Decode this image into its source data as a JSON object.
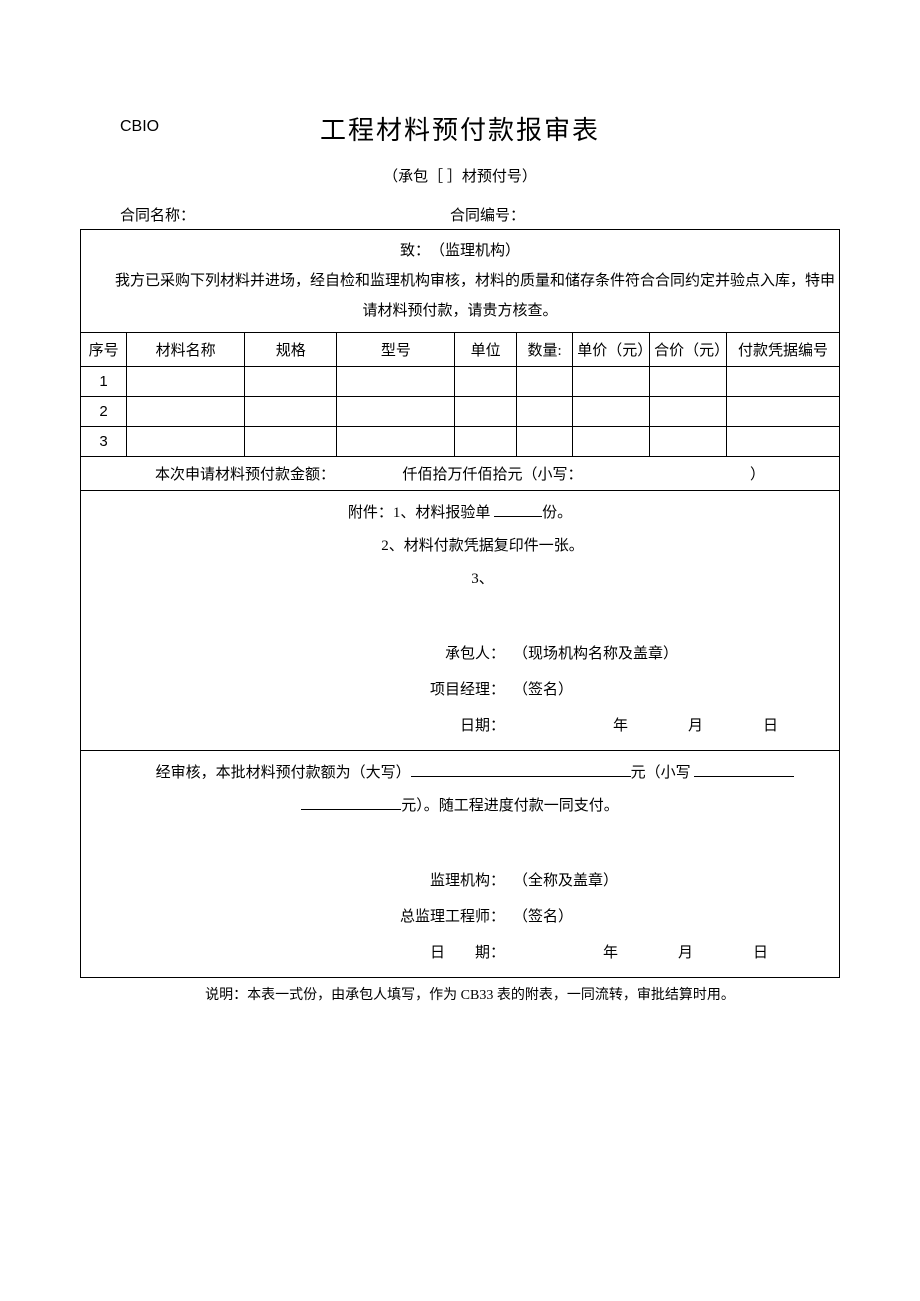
{
  "doc_code": "CBIO",
  "title": "工程材料预付款报审表",
  "subtitle": "（承包［ ］材预付号）",
  "contract": {
    "name_label": "合同名称：",
    "no_label": "合同编号："
  },
  "intro": {
    "to": "致：　（监理机构）",
    "body": "我方已采购下列材料并进场，经自检和监理机构审核，材料的质量和储存条件符合合同约定并验点入库，特申请材料预付款，请贵方核查。"
  },
  "headers": {
    "seq": "序号",
    "name": "材料名称",
    "spec": "规格",
    "model": "型号",
    "unit": "单位",
    "qty": "数量:",
    "unit_price": "单价（元）",
    "total_price": "合价（元）",
    "voucher": "付款凭据编号"
  },
  "rows": [
    {
      "seq": "1",
      "name": "",
      "spec": "",
      "model": "",
      "unit": "",
      "qty": "",
      "unit_price": "",
      "total_price": "",
      "voucher": ""
    },
    {
      "seq": "2",
      "name": "",
      "spec": "",
      "model": "",
      "unit": "",
      "qty": "",
      "unit_price": "",
      "total_price": "",
      "voucher": ""
    },
    {
      "seq": "3",
      "name": "",
      "spec": "",
      "model": "",
      "unit": "",
      "qty": "",
      "unit_price": "",
      "total_price": "",
      "voucher": ""
    }
  ],
  "amount_line": {
    "prefix": "本次申请材料预付款金额：",
    "cn_units": "仟佰拾万仟佰拾元（小写：",
    "suffix": "）"
  },
  "attachments": {
    "label": "附件：",
    "item1_pre": "1、材料报验单 ",
    "item1_post": "份。",
    "item2": "2、材料付款凭据复印件一张。",
    "item3": "3、"
  },
  "sig1": {
    "contractor_label": "承包人：",
    "contractor_val": "（现场机构名称及盖章）",
    "pm_label": "项目经理：",
    "pm_val": "（签名）",
    "date_label": "日期：",
    "year": "年",
    "month": "月",
    "day": "日"
  },
  "review": {
    "text_pre": "经审核，本批材料预付款额为（大写）",
    "text_mid": "元（小写 ",
    "text_post": "元）。随工程进度付款一同支付。"
  },
  "sig2": {
    "org_label": "监理机构：",
    "org_val": "（全称及盖章）",
    "eng_label": "总监理工程师：",
    "eng_val": "（签名）",
    "date_label": "日　　期：",
    "year": "年",
    "month": "月",
    "day": "日"
  },
  "footer": "说明：本表一式份，由承包人填写，作为 CB33 表的附表，一同流转，审批结算时用。"
}
